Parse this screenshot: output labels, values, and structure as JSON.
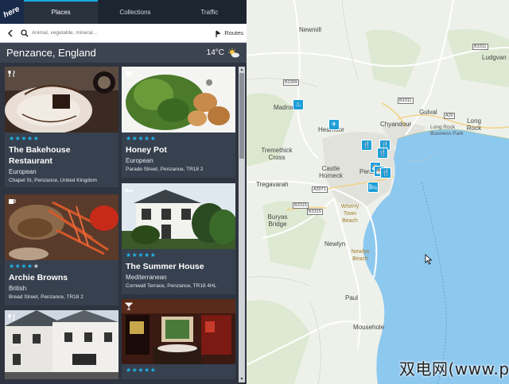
{
  "tabs": [
    {
      "label": "Places",
      "active": true
    },
    {
      "label": "Collections",
      "active": false
    },
    {
      "label": "Traffic",
      "active": false
    }
  ],
  "logo": {
    "text": "here"
  },
  "search": {
    "placeholder": "Animal, vegetable, mineral...",
    "value": "",
    "routes_label": "Routes"
  },
  "location": {
    "city": "Penzance, England",
    "temperature": "14°C",
    "weather_icon": "sun-cloud-icon"
  },
  "cards": [
    {
      "name": "The Bakehouse Restaurant",
      "cuisine": "European",
      "address": "Chapel St, Penzance, United Kingdom",
      "rating": 5,
      "category_icon": "restaurant-icon"
    },
    {
      "name": "Honey Pot",
      "cuisine": "European",
      "address": "Parade Street, Penzance, TR18 2",
      "rating": 5,
      "category_icon": "coffee-icon"
    },
    {
      "name": "Archie Browns",
      "cuisine": "British",
      "address": "Bread Street, Penzance, TR18 2",
      "rating": 4,
      "category_icon": "coffee-icon"
    },
    {
      "name": "The Summer House",
      "cuisine": "Mediterranean",
      "address": "Cornwall Terrace, Penzance, TR18 4HL",
      "rating": 5,
      "category_icon": "hotel-icon"
    },
    {
      "name": "",
      "cuisine": "",
      "address": "",
      "rating": 0,
      "category_icon": "restaurant-icon"
    },
    {
      "name": "",
      "cuisine": "",
      "address": "",
      "rating": 5,
      "category_icon": "bar-icon"
    }
  ],
  "map": {
    "places": [
      "Newmill",
      "Ludgvan",
      "Madron",
      "Heamoor",
      "Gulval",
      "Chyandour",
      "Long Rock",
      "Long Rock Business Park",
      "Tremethick Cross",
      "Castle Horneck",
      "Penzance",
      "Tregavarah",
      "Buryas Bridge",
      "Wherry Town Beach",
      "Newlyn",
      "Newlyn Beach",
      "Paul",
      "Mousehole"
    ],
    "roads": [
      "B3311",
      "B3309",
      "B3311",
      "A30",
      "B3315",
      "B3315",
      "A3071"
    ],
    "watermark": "双电网(www.pcpc.me)"
  },
  "colors": {
    "accent": "#1fb5ea",
    "panel": "#2e3440",
    "sea": "#8dc8ef"
  }
}
